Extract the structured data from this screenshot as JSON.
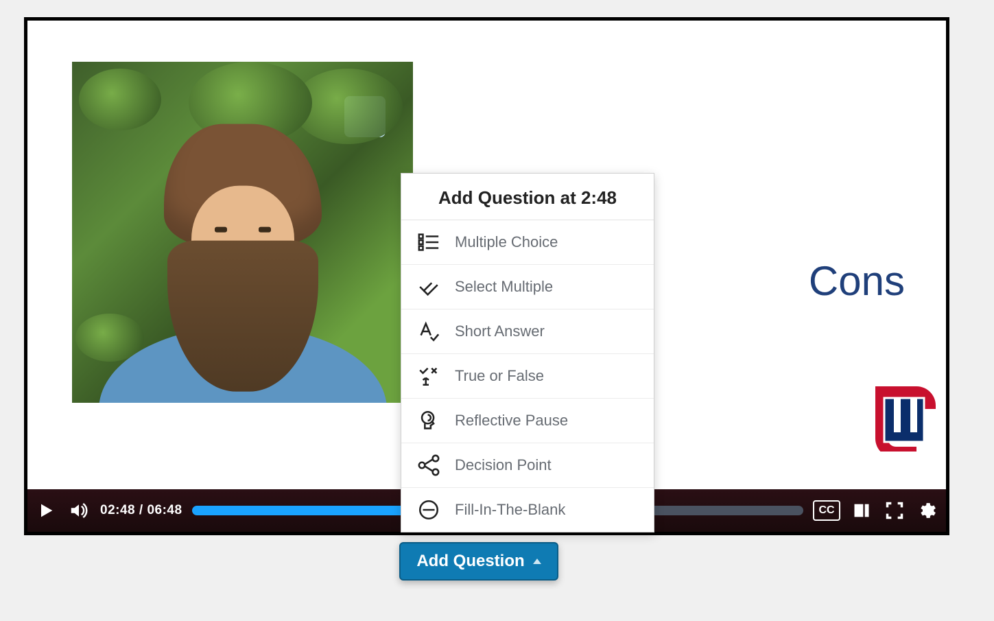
{
  "video": {
    "current_time": "02:48",
    "total_time": "06:48",
    "cc_label": "CC",
    "progress_percent": 41.2,
    "slide_text_visible": "Cons"
  },
  "popover": {
    "title": "Add Question at 2:48",
    "items": [
      {
        "label": "Multiple Choice"
      },
      {
        "label": "Select Multiple"
      },
      {
        "label": "Short Answer"
      },
      {
        "label": "True or False"
      },
      {
        "label": "Reflective Pause"
      },
      {
        "label": "Decision Point"
      },
      {
        "label": "Fill-In-The-Blank"
      }
    ]
  },
  "buttons": {
    "add_question": "Add Question"
  }
}
